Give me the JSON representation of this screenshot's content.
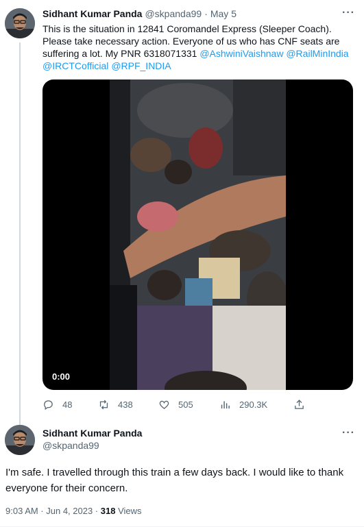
{
  "tweet": {
    "author_name": "Sidhant Kumar Panda",
    "handle": "@skpanda99",
    "dot": "·",
    "date": "May 5",
    "more": "···",
    "text_main": "This is the situation in 12841 Coromandel Express (Sleeper Coach). Please take necessary action. Everyone of us who has CNF seats are suffering a lot. My PNR 6318071331 ",
    "mentions": [
      "@AshwiniVaishnaw",
      "@RailMinIndia",
      "@IRCTCofficial",
      "@RPF_INDIA"
    ],
    "video_time": "0:00",
    "actions": {
      "replies": "48",
      "retweets": "438",
      "likes": "505",
      "views": "290.3K"
    }
  },
  "reply": {
    "author_name": "Sidhant Kumar Panda",
    "handle": "@skpanda99",
    "more": "···",
    "text": "I'm safe. I travelled through this train a few days back. I would like to thank everyone for their concern.",
    "time": "9:03 AM · Jun 4, 2023 · ",
    "views_count": "318",
    "views_label": " Views"
  },
  "icons": {
    "reply": "reply-icon",
    "retweet": "retweet-icon",
    "like": "heart-icon",
    "views": "views-icon",
    "share": "share-icon"
  },
  "colors": {
    "link": "#1d9bf0",
    "muted": "#536471",
    "text": "#0f1419"
  }
}
